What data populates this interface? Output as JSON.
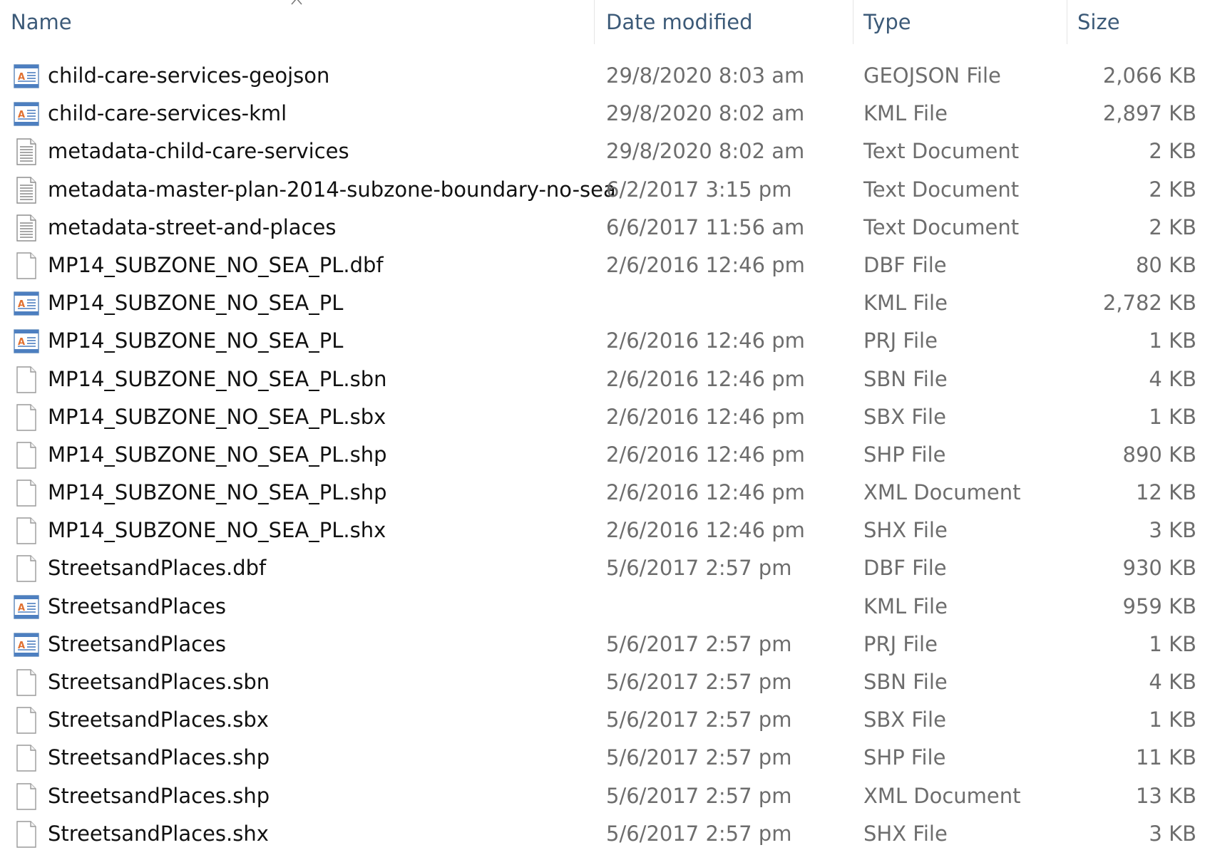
{
  "columns": {
    "name": "Name",
    "date_modified": "Date modified",
    "type": "Type",
    "size": "Size"
  },
  "colors": {
    "header_text": "#3c5a78",
    "primary_text": "#111111",
    "secondary_text": "#6d6d6d"
  },
  "files": [
    {
      "name": "child-care-services-geojson",
      "date": "29/8/2020 8:03 am",
      "type": "GEOJSON File",
      "size": "2,066 KB",
      "icon": "app-document-icon"
    },
    {
      "name": "child-care-services-kml",
      "date": "29/8/2020 8:02 am",
      "type": "KML File",
      "size": "2,897 KB",
      "icon": "app-document-icon"
    },
    {
      "name": "metadata-child-care-services",
      "date": "29/8/2020 8:02 am",
      "type": "Text Document",
      "size": "2 KB",
      "icon": "text-document-icon"
    },
    {
      "name": "metadata-master-plan-2014-subzone-boundary-no-sea",
      "date": "6/2/2017 3:15 pm",
      "type": "Text Document",
      "size": "2 KB",
      "icon": "text-document-icon"
    },
    {
      "name": "metadata-street-and-places",
      "date": "6/6/2017 11:56 am",
      "type": "Text Document",
      "size": "2 KB",
      "icon": "text-document-icon"
    },
    {
      "name": "MP14_SUBZONE_NO_SEA_PL.dbf",
      "date": "2/6/2016 12:46 pm",
      "type": "DBF File",
      "size": "80 KB",
      "icon": "blank-file-icon"
    },
    {
      "name": "MP14_SUBZONE_NO_SEA_PL",
      "date": "",
      "type": "KML File",
      "size": "2,782 KB",
      "icon": "app-document-icon"
    },
    {
      "name": "MP14_SUBZONE_NO_SEA_PL",
      "date": "2/6/2016 12:46 pm",
      "type": "PRJ File",
      "size": "1 KB",
      "icon": "app-document-icon"
    },
    {
      "name": "MP14_SUBZONE_NO_SEA_PL.sbn",
      "date": "2/6/2016 12:46 pm",
      "type": "SBN File",
      "size": "4 KB",
      "icon": "blank-file-icon"
    },
    {
      "name": "MP14_SUBZONE_NO_SEA_PL.sbx",
      "date": "2/6/2016 12:46 pm",
      "type": "SBX File",
      "size": "1 KB",
      "icon": "blank-file-icon"
    },
    {
      "name": "MP14_SUBZONE_NO_SEA_PL.shp",
      "date": "2/6/2016 12:46 pm",
      "type": "SHP File",
      "size": "890 KB",
      "icon": "blank-file-icon"
    },
    {
      "name": "MP14_SUBZONE_NO_SEA_PL.shp",
      "date": "2/6/2016 12:46 pm",
      "type": "XML Document",
      "size": "12 KB",
      "icon": "blank-file-icon"
    },
    {
      "name": "MP14_SUBZONE_NO_SEA_PL.shx",
      "date": "2/6/2016 12:46 pm",
      "type": "SHX File",
      "size": "3 KB",
      "icon": "blank-file-icon"
    },
    {
      "name": "StreetsandPlaces.dbf",
      "date": "5/6/2017 2:57 pm",
      "type": "DBF File",
      "size": "930 KB",
      "icon": "blank-file-icon"
    },
    {
      "name": "StreetsandPlaces",
      "date": "",
      "type": "KML File",
      "size": "959 KB",
      "icon": "app-document-icon"
    },
    {
      "name": "StreetsandPlaces",
      "date": "5/6/2017 2:57 pm",
      "type": "PRJ File",
      "size": "1 KB",
      "icon": "app-document-icon"
    },
    {
      "name": "StreetsandPlaces.sbn",
      "date": "5/6/2017 2:57 pm",
      "type": "SBN File",
      "size": "4 KB",
      "icon": "blank-file-icon"
    },
    {
      "name": "StreetsandPlaces.sbx",
      "date": "5/6/2017 2:57 pm",
      "type": "SBX File",
      "size": "1 KB",
      "icon": "blank-file-icon"
    },
    {
      "name": "StreetsandPlaces.shp",
      "date": "5/6/2017 2:57 pm",
      "type": "SHP File",
      "size": "11 KB",
      "icon": "blank-file-icon"
    },
    {
      "name": "StreetsandPlaces.shp",
      "date": "5/6/2017 2:57 pm",
      "type": "XML Document",
      "size": "13 KB",
      "icon": "blank-file-icon"
    },
    {
      "name": "StreetsandPlaces.shx",
      "date": "5/6/2017 2:57 pm",
      "type": "SHX File",
      "size": "3 KB",
      "icon": "blank-file-icon"
    }
  ]
}
